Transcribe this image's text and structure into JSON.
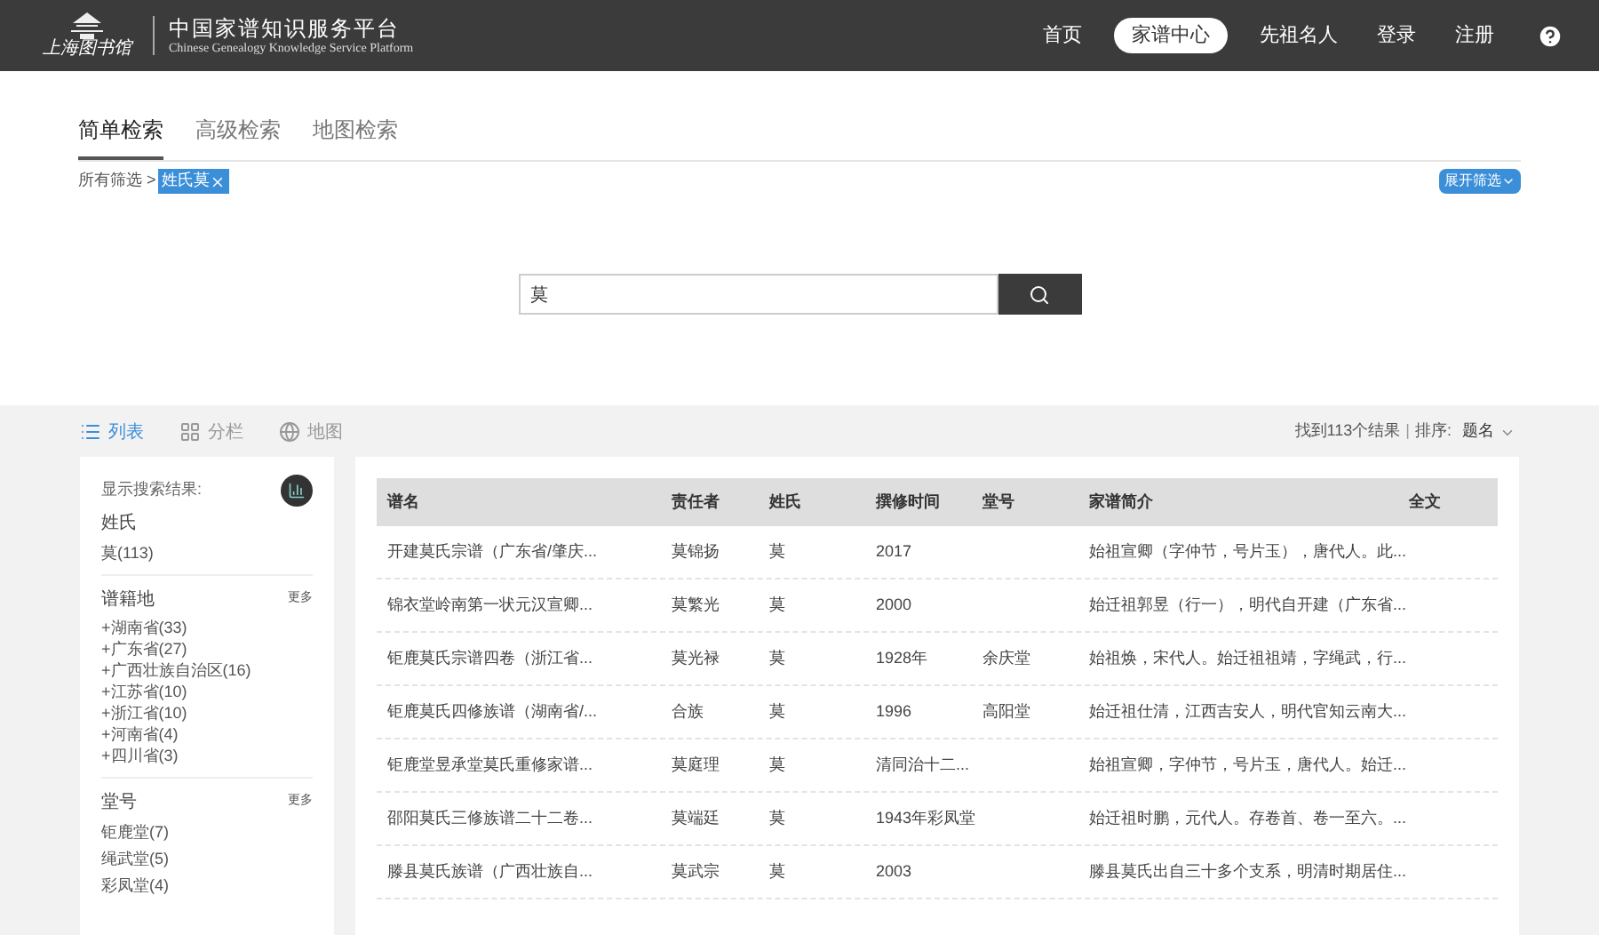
{
  "header": {
    "logo_text": "上海图书馆",
    "title": "中国家谱知识服务平台",
    "subtitle": "Chinese Genealogy Knowledge Service Platform",
    "nav": [
      {
        "label": "首页",
        "selected": false
      },
      {
        "label": "家谱中心",
        "selected": true
      },
      {
        "label": "先祖名人",
        "selected": false
      },
      {
        "label": "登录",
        "selected": false
      },
      {
        "label": "注册",
        "selected": false
      }
    ]
  },
  "search_tabs": [
    {
      "label": "简单检索",
      "selected": true
    },
    {
      "label": "高级检索",
      "selected": false
    },
    {
      "label": "地图检索",
      "selected": false
    }
  ],
  "filter": {
    "prefix": "所有筛选 >",
    "tag": "姓氏莫",
    "expand": "展开筛选"
  },
  "search": {
    "value": "莫"
  },
  "views": [
    {
      "label": "列表",
      "kind": "list",
      "selected": true
    },
    {
      "label": "分栏",
      "kind": "grid",
      "selected": false
    },
    {
      "label": "地图",
      "kind": "globe",
      "selected": false
    }
  ],
  "result_info": {
    "count": "找到113个结果",
    "separator": "|",
    "sort_label": "排序:",
    "sort_value": "题名"
  },
  "sidebar": {
    "title": "显示搜索结果:",
    "groups": [
      {
        "title": "姓氏",
        "items": [
          "莫(113)"
        ]
      },
      {
        "title": "谱籍地",
        "more": "更多",
        "items": [
          "+湖南省(33)",
          "+广东省(27)",
          "+广西壮族自治区(16)",
          "+江苏省(10)",
          "+浙江省(10)",
          "+河南省(4)",
          "+四川省(3)"
        ]
      },
      {
        "title": "堂号",
        "more": "更多",
        "items": [
          "钜鹿堂(7)",
          "绳武堂(5)",
          "彩凤堂(4)"
        ]
      }
    ]
  },
  "table": {
    "columns": [
      "谱名",
      "责任者",
      "姓氏",
      "撰修时间",
      "堂号",
      "家谱简介",
      "全文"
    ],
    "rows": [
      [
        "开建莫氏宗谱（广东省/肇庆...",
        "莫锦扬",
        "莫",
        "2017",
        "",
        "始祖宣卿（字仲节，号片玉），唐代人。此..."
      ],
      [
        "锦衣堂岭南第一状元汉宣卿...",
        "莫繁光",
        "莫",
        "2000",
        "",
        "始迁祖郭昱（行一），明代自开建（广东省..."
      ],
      [
        "钜鹿莫氏宗谱四卷（浙江省...",
        "莫光禄",
        "莫",
        "1928年",
        "余庆堂",
        "始祖焕，宋代人。始迁祖祖靖，字绳武，行..."
      ],
      [
        "钜鹿莫氏四修族谱（湖南省/...",
        "合族",
        "莫",
        "1996",
        "高阳堂",
        "始迁祖仕清，江西吉安人，明代官知云南大..."
      ],
      [
        "钜鹿堂昱承堂莫氏重修家谱...",
        "莫庭理",
        "莫",
        "清同治十二...",
        "",
        "始祖宣卿，字仲节，号片玉，唐代人。始迁..."
      ],
      [
        "邵阳莫氏三修族谱二十二卷...",
        "莫端廷",
        "莫",
        "1943年彩凤堂",
        "",
        "始迁祖时鹏，元代人。存卷首、卷一至六。..."
      ],
      [
        "滕县莫氏族谱（广西壮族自...",
        "莫武宗",
        "莫",
        "2003",
        "",
        "滕县莫氏出自三十多个支系，明清时期居住..."
      ]
    ]
  }
}
